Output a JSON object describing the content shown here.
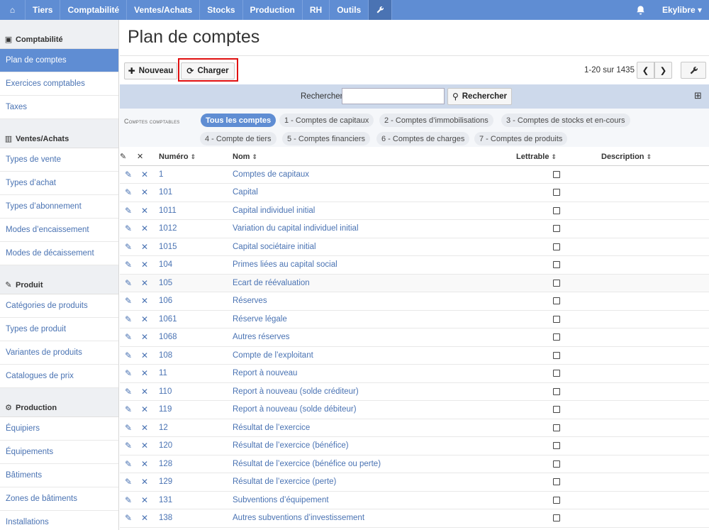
{
  "topnav": {
    "home_icon": "home-icon",
    "items": [
      "Tiers",
      "Comptabilité",
      "Ventes/Achats",
      "Stocks",
      "Production",
      "RH",
      "Outils"
    ],
    "tools_icon": "wrench-icon",
    "bell_icon": "bell-icon",
    "user": "Ekylibre ▾"
  },
  "sidebar": {
    "sections": [
      {
        "title": "Comptabilité",
        "icon": "money-icon",
        "items": [
          "Plan de comptes",
          "Exercices comptables",
          "Taxes"
        ]
      },
      {
        "title": "Ventes/Achats",
        "icon": "bar-chart-icon",
        "items": [
          "Types de vente",
          "Types d’achat",
          "Types d’abonnement",
          "Modes d’encaissement",
          "Modes de décaissement"
        ]
      },
      {
        "title": "Produit",
        "icon": "feather-icon",
        "items": [
          "Catégories de produits",
          "Types de produit",
          "Variantes de produits",
          "Catalogues de prix"
        ]
      },
      {
        "title": "Production",
        "icon": "gears-icon",
        "items": [
          "Équipiers",
          "Équipements",
          "Bâtiments",
          "Zones de bâtiments",
          "Installations"
        ]
      }
    ]
  },
  "page": {
    "title": "Plan de comptes",
    "new_label": "Nouveau",
    "charger_label": "Charger",
    "pagination": "1-20 sur 1435",
    "search_label": "Rechercher",
    "search_placeholder": "",
    "search_button": "Rechercher"
  },
  "filters": {
    "label": "Comptes comptables",
    "tags": [
      "Tous les comptes",
      "1 - Comptes de capitaux",
      "2 - Comptes d’immobilisations",
      "3 - Comptes de stocks et en-cours",
      "4 - Compte de tiers",
      "5 - Comptes financiers",
      "6 - Comptes de charges",
      "7 - Comptes de produits"
    ],
    "active": "Tous les comptes"
  },
  "table": {
    "headers": {
      "numero": "Numéro",
      "nom": "Nom",
      "lettrable": "Lettrable",
      "description": "Description"
    },
    "rows": [
      {
        "numero": "1",
        "nom": "Comptes de capitaux"
      },
      {
        "numero": "101",
        "nom": "Capital"
      },
      {
        "numero": "1011",
        "nom": "Capital individuel initial"
      },
      {
        "numero": "1012",
        "nom": "Variation du capital individuel initial"
      },
      {
        "numero": "1015",
        "nom": "Capital sociétaire initial"
      },
      {
        "numero": "104",
        "nom": "Primes liées au capital social"
      },
      {
        "numero": "105",
        "nom": "Ecart de réévaluation"
      },
      {
        "numero": "106",
        "nom": "Réserves"
      },
      {
        "numero": "1061",
        "nom": "Réserve légale"
      },
      {
        "numero": "1068",
        "nom": "Autres réserves"
      },
      {
        "numero": "108",
        "nom": "Compte de l’exploitant"
      },
      {
        "numero": "11",
        "nom": "Report à nouveau"
      },
      {
        "numero": "110",
        "nom": "Report à nouveau (solde créditeur)"
      },
      {
        "numero": "119",
        "nom": "Report à nouveau (solde débiteur)"
      },
      {
        "numero": "12",
        "nom": "Résultat de l’exercice"
      },
      {
        "numero": "120",
        "nom": "Résultat de l’exercice (bénéfice)"
      },
      {
        "numero": "128",
        "nom": "Résultat de l’exercice (bénéfice ou perte)"
      },
      {
        "numero": "129",
        "nom": "Résultat de l’exercice (perte)"
      },
      {
        "numero": "131",
        "nom": "Subventions d’équipement"
      },
      {
        "numero": "138",
        "nom": "Autres subventions d’investissement"
      }
    ]
  },
  "colors": {
    "primary": "#5f8dd3",
    "link": "#4a73b3",
    "highlight": "#e01010",
    "searchbar": "#cdd9eb"
  }
}
